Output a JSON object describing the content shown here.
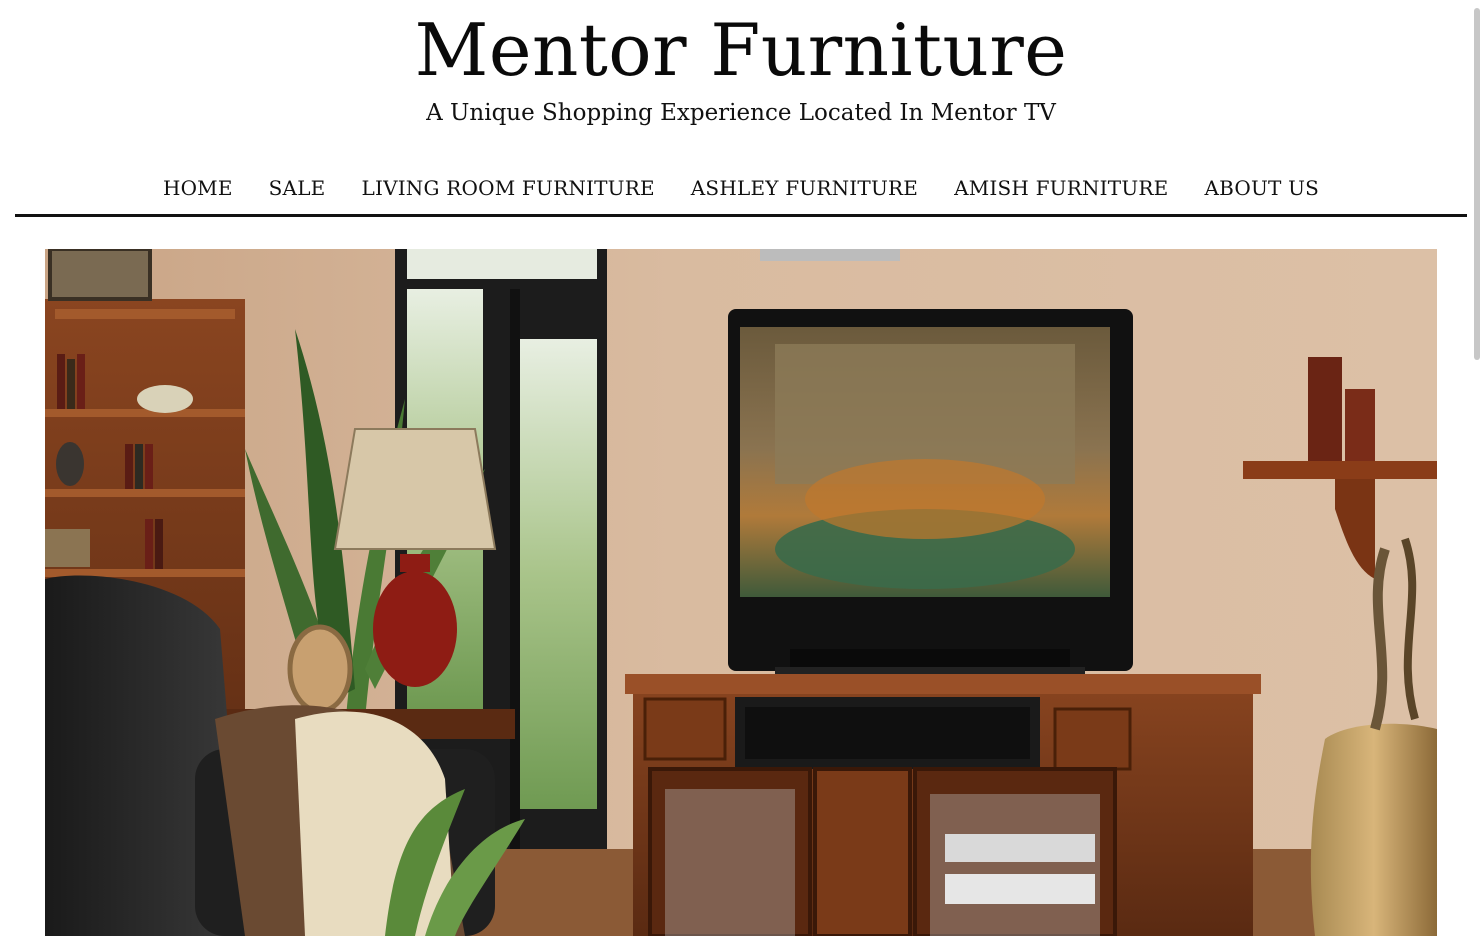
{
  "site": {
    "title": "Mentor Furniture",
    "tagline": "A Unique Shopping Experience Located In Mentor TV"
  },
  "nav": {
    "items": [
      {
        "label": "HOME"
      },
      {
        "label": "SALE"
      },
      {
        "label": "LIVING ROOM FURNITURE"
      },
      {
        "label": "ASHLEY FURNITURE"
      },
      {
        "label": "AMISH FURNITURE"
      },
      {
        "label": "ABOUT US"
      }
    ]
  },
  "hero": {
    "description_icon": "living-room-entertainment-center-photo"
  },
  "colors": {
    "text": "#111111",
    "background": "#ffffff",
    "rule": "#111111",
    "wall": "#d4b59a",
    "wood": "#7a3b1c"
  }
}
